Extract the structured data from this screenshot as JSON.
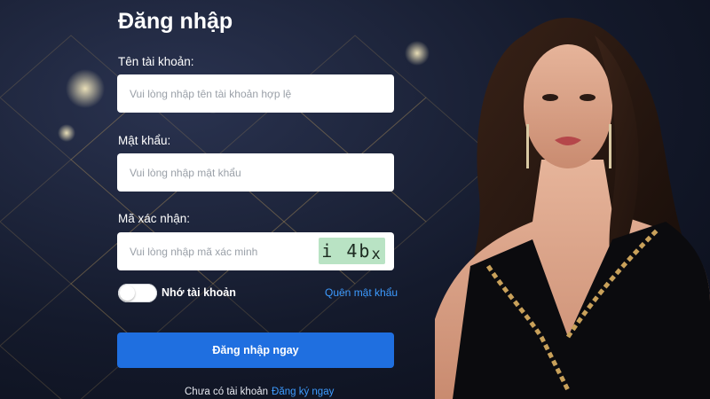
{
  "login": {
    "title": "Đăng nhập",
    "username": {
      "label": "Tên tài khoản:",
      "placeholder": "Vui lòng nhập tên tài khoản hợp lệ"
    },
    "password": {
      "label": "Mật khẩu:",
      "placeholder": "Vui lòng nhập mật khẩu"
    },
    "captcha": {
      "label": "Mã xác nhận:",
      "placeholder": "Vui lòng nhập mã xác minh",
      "code_main": "i 4b",
      "code_last": "x"
    },
    "remember_label": "Nhớ tài khoản",
    "remember_checked": false,
    "forgot_link": "Quên mật khẩu",
    "submit_label": "Đăng nhập ngay",
    "signup_prompt": "Chưa có tài khoản",
    "signup_link": "Đăng ký ngay"
  },
  "colors": {
    "accent": "#1f6fe0",
    "link": "#3d9bff",
    "captcha_bg": "#b9e3c4",
    "background": "#141a2c"
  },
  "decor": {
    "promo_image": "woman-in-black-dress-photo"
  }
}
